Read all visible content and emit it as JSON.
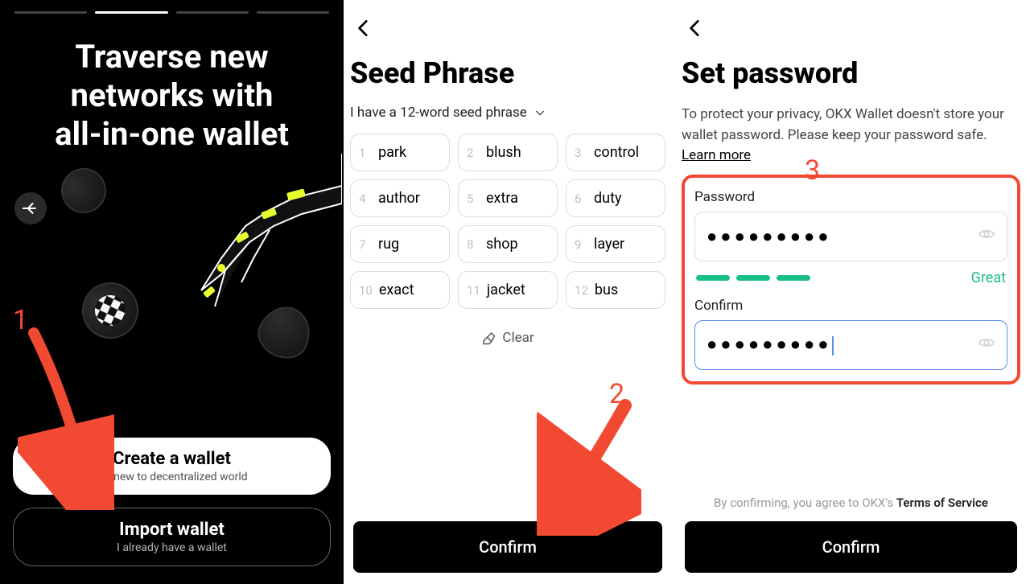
{
  "annotations": {
    "n1": "1",
    "n2": "2",
    "n3": "3"
  },
  "screen1": {
    "title_lines": [
      "Traverse new",
      "networks with",
      "all-in-one wallet"
    ],
    "create": {
      "title": "Create a wallet",
      "sub": "I'm new to decentralized world"
    },
    "import": {
      "title": "Import wallet",
      "sub": "I already have a wallet"
    }
  },
  "screen2": {
    "title": "Seed Phrase",
    "selector": "I have a 12-word seed phrase",
    "words": [
      "park",
      "blush",
      "control",
      "author",
      "extra",
      "duty",
      "rug",
      "shop",
      "layer",
      "exact",
      "jacket",
      "bus"
    ],
    "clear": "Clear",
    "confirm": "Confirm"
  },
  "screen3": {
    "title": "Set password",
    "desc_a": "To protect your privacy, OKX Wallet doesn't store your wallet password. Please keep your password safe.  ",
    "learn_more": "Learn more",
    "password_label": "Password",
    "confirm_label": "Confirm",
    "password_mask": "●●●●●●●●●",
    "confirm_mask": "●●●●●●●●●",
    "strength": "Great",
    "tos_a": "By confirming, you agree to OKX's ",
    "tos_b": "Terms of Service",
    "confirm_btn": "Confirm"
  }
}
